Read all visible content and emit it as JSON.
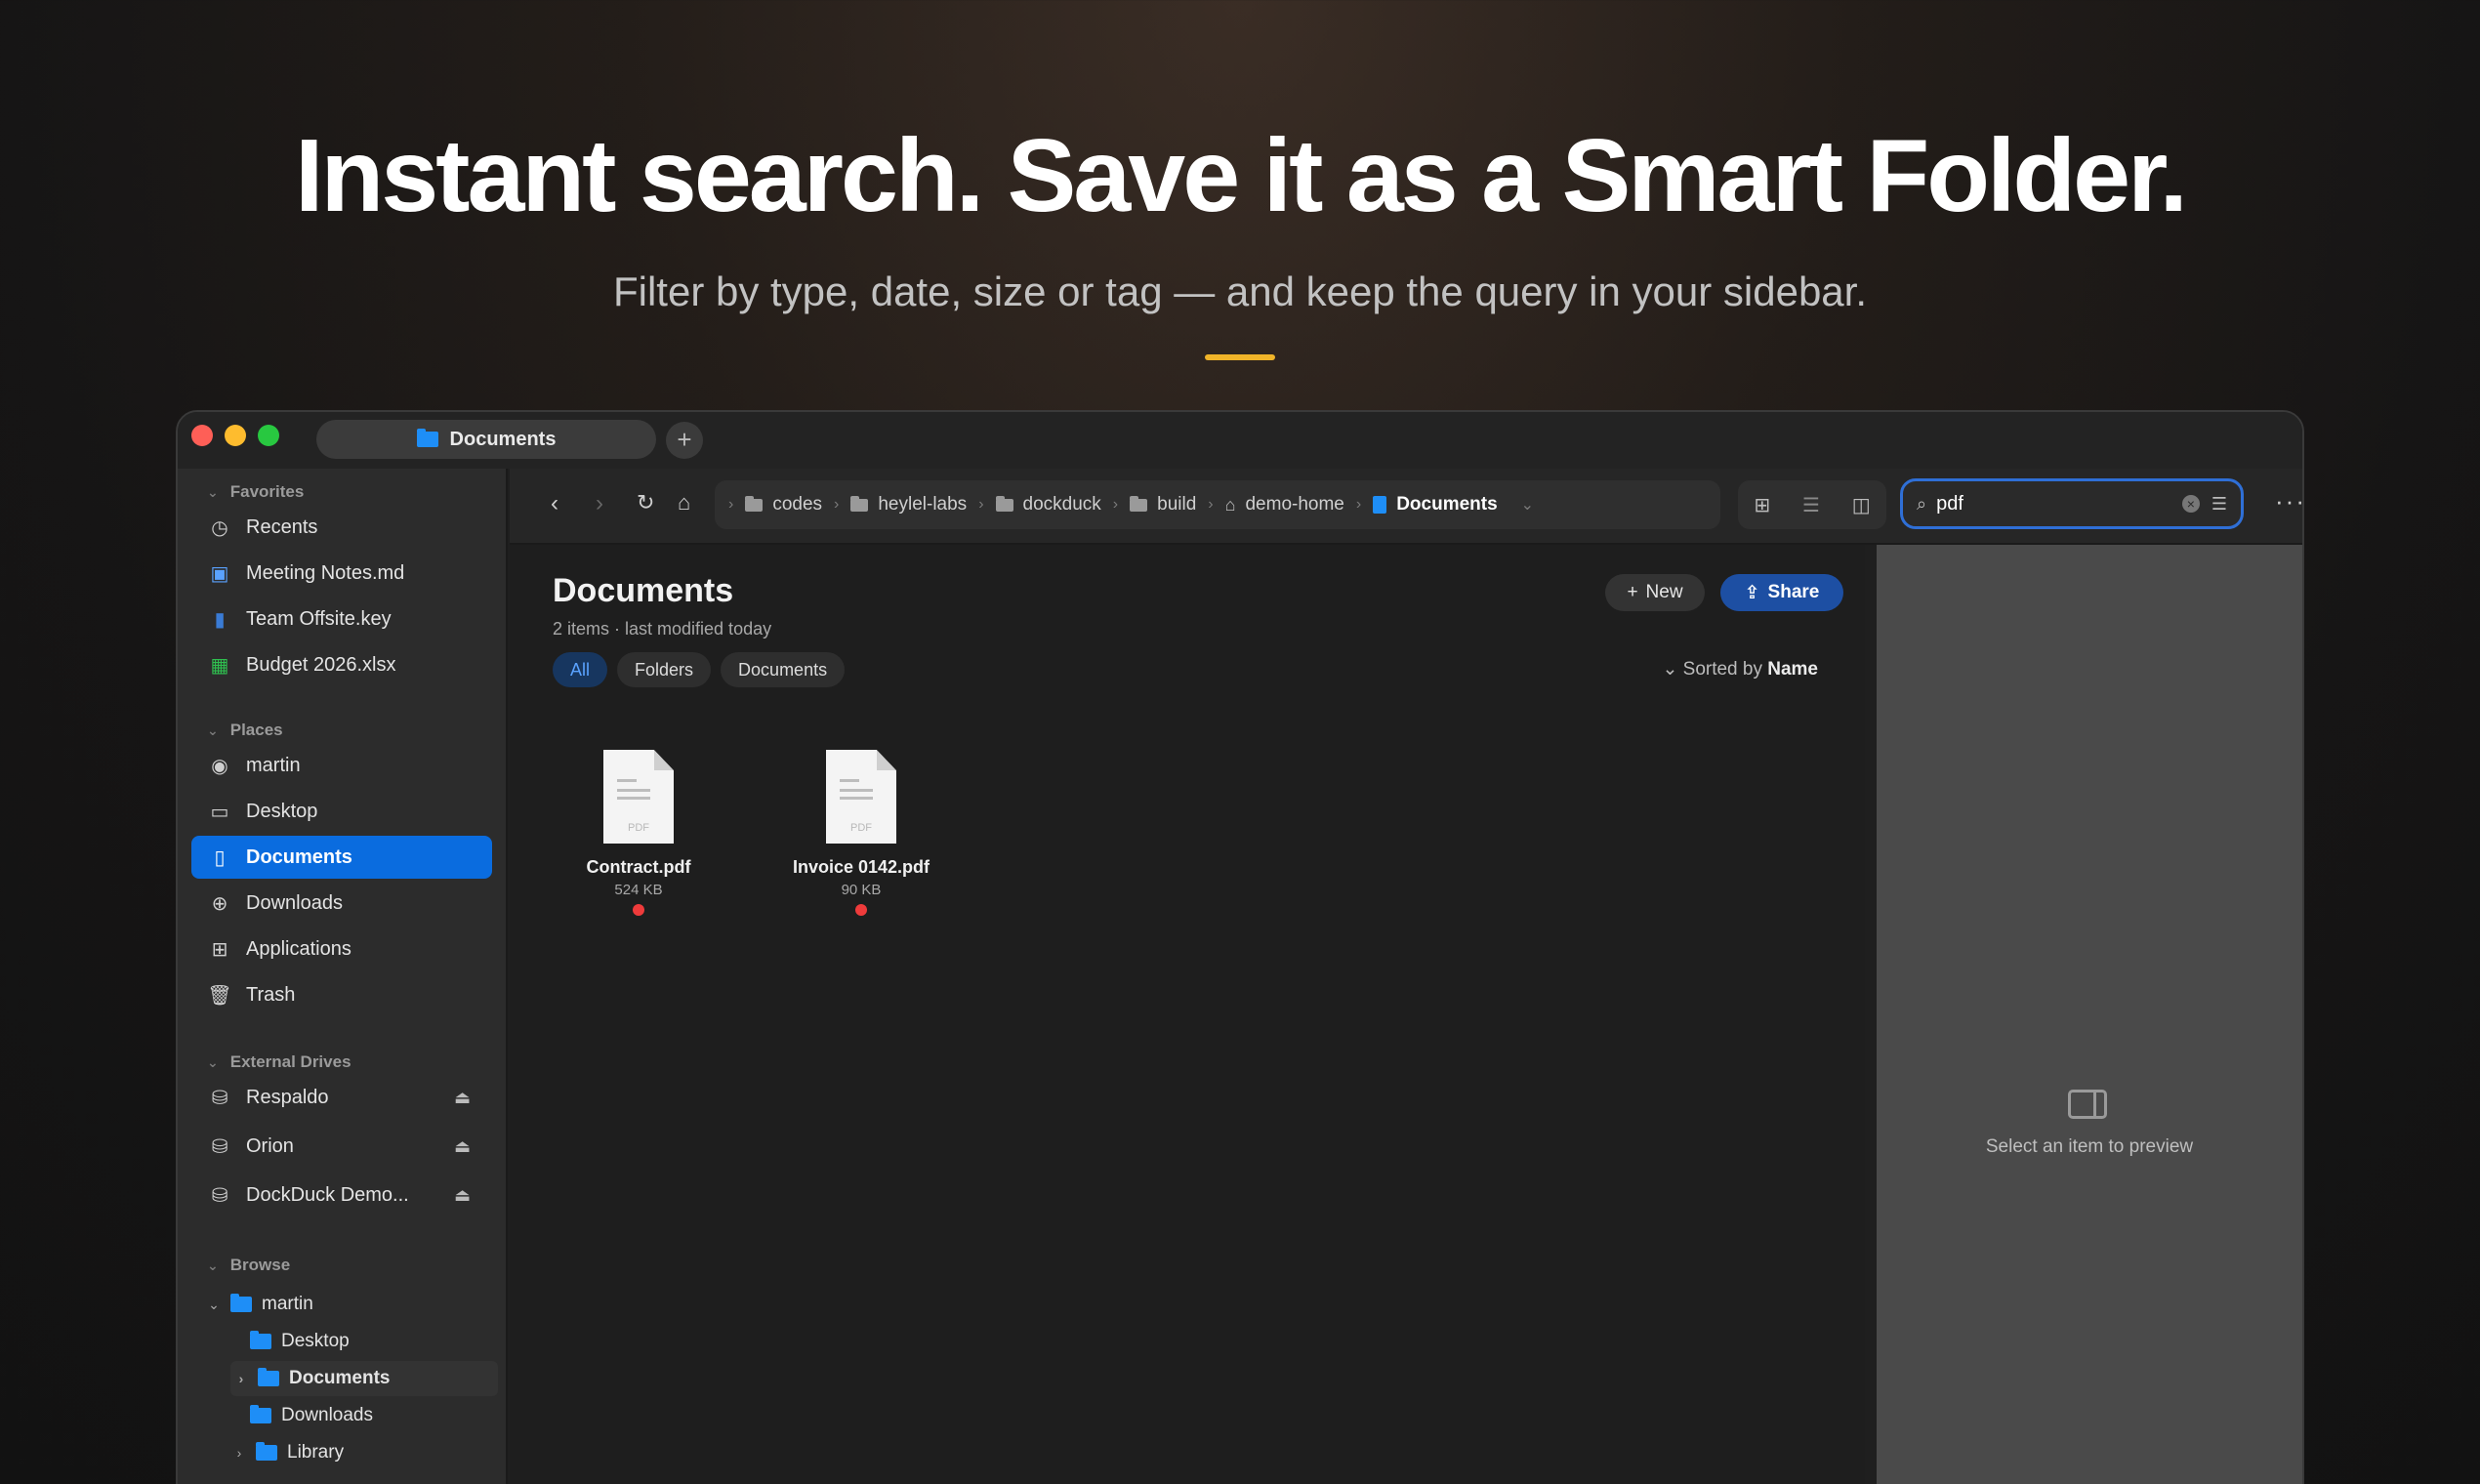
{
  "hero": {
    "title": "Instant search. Save it as a Smart Folder.",
    "subtitle": "Filter by type, date, size or tag — and keep the query in your sidebar.",
    "accent": "#f0b429"
  },
  "window": {
    "tab_label": "Documents",
    "new_tab": "+"
  },
  "sidebar": {
    "favorites": {
      "heading": "Favorites",
      "items": [
        {
          "label": "Recents",
          "icon": "clock-icon"
        },
        {
          "label": "Meeting Notes.md",
          "icon": "markdown-file-icon"
        },
        {
          "label": "Team Offsite.key",
          "icon": "keynote-file-icon"
        },
        {
          "label": "Budget 2026.xlsx",
          "icon": "spreadsheet-file-icon"
        }
      ]
    },
    "places": {
      "heading": "Places",
      "items": [
        {
          "label": "martin",
          "icon": "user-icon"
        },
        {
          "label": "Desktop",
          "icon": "desktop-icon"
        },
        {
          "label": "Documents",
          "icon": "document-icon"
        },
        {
          "label": "Downloads",
          "icon": "download-icon"
        },
        {
          "label": "Applications",
          "icon": "grid-icon"
        },
        {
          "label": "Trash",
          "icon": "trash-icon"
        }
      ]
    },
    "external": {
      "heading": "External Drives",
      "items": [
        {
          "label": "Respaldo",
          "icon": "drive-icon"
        },
        {
          "label": "Orion",
          "icon": "drive-icon"
        },
        {
          "label": "DockDuck Demo...",
          "icon": "drive-icon"
        }
      ]
    },
    "browse": {
      "heading": "Browse",
      "root": "martin",
      "children": [
        "Desktop",
        "Documents",
        "Downloads",
        "Library"
      ]
    }
  },
  "toolbar": {
    "breadcrumb": [
      "codes",
      "heylel-labs",
      "dockduck",
      "build",
      "demo-home",
      "Documents"
    ],
    "search": {
      "value": "pdf",
      "placeholder": "Search"
    }
  },
  "content": {
    "title": "Documents",
    "subtitle": "2 items · last modified today",
    "new_label": "New",
    "share_label": "Share",
    "filters": [
      "All",
      "Folders",
      "Documents"
    ],
    "sorted_prefix": "Sorted by",
    "sorted_value": "Name",
    "files": [
      {
        "name": "Contract.pdf",
        "size": "524 KB",
        "kind": "PDF",
        "tag_color": "#ef3b3b"
      },
      {
        "name": "Invoice 0142.pdf",
        "size": "90 KB",
        "kind": "PDF",
        "tag_color": "#ef3b3b"
      }
    ]
  },
  "preview": {
    "empty_text": "Select an item to preview"
  }
}
